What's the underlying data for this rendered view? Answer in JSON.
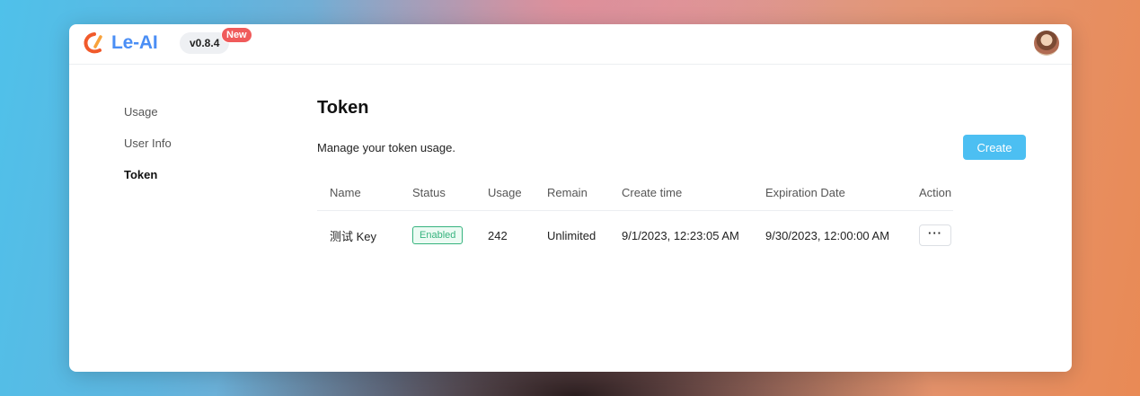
{
  "app": {
    "name": "Le-AI",
    "version": "v0.8.4",
    "new_badge": "New",
    "brand_color": "#4a8ef5",
    "logo_icon": "le-ai-logo-icon"
  },
  "sidebar": {
    "items": [
      {
        "label": "Usage",
        "active": false
      },
      {
        "label": "User Info",
        "active": false
      },
      {
        "label": "Token",
        "active": true
      }
    ]
  },
  "main": {
    "title": "Token",
    "subtitle": "Manage your token usage.",
    "create_label": "Create",
    "accent_color": "#4cbff2"
  },
  "table": {
    "headers": [
      "Name",
      "Status",
      "Usage",
      "Remain",
      "Create time",
      "Expiration Date",
      "Action"
    ],
    "rows": [
      {
        "name": "测试 Key",
        "status": "Enabled",
        "usage": "242",
        "remain": "Unlimited",
        "create_time": "9/1/2023, 12:23:05 AM",
        "expiration_date": "9/30/2023, 12:00:00 AM",
        "action_label": "···"
      }
    ]
  }
}
